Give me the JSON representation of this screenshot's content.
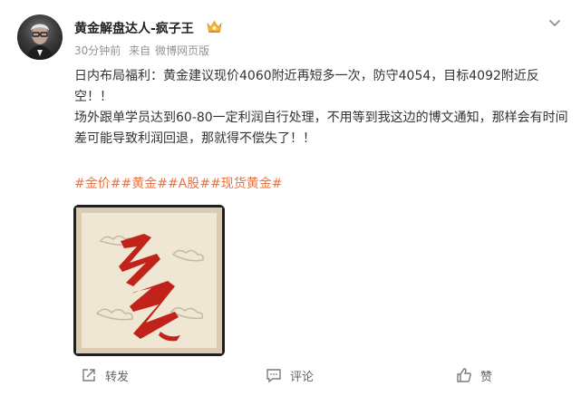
{
  "post": {
    "author": "黄金解盘达人-疯子王",
    "time": "30分钟前",
    "source_prefix": "来自",
    "source": "微博网页版",
    "text_line1": "日内布局福利：黄金建议现价4060附近再短多一次，防守4054，目标4092附近反空！！",
    "text_line2": "场外跟单学员达到60-80一定利润自行处理，不用等到我这边的博文通知，那样会有时间差可能导致利润回退，那就得不偿失了！！",
    "tags": [
      "#金价#",
      "#黄金#",
      "#A股#",
      "#现货黄金#"
    ],
    "image_glyph": "多",
    "colors": {
      "tag": "#eb7340",
      "glyph": "#c1221a",
      "paper": "#efe6d3"
    }
  },
  "actions": {
    "repost": "转发",
    "comment": "评论",
    "like": "赞"
  },
  "icons": [
    "vip-crown-icon",
    "chevron-down-icon",
    "repost-icon",
    "comment-icon",
    "like-icon"
  ]
}
